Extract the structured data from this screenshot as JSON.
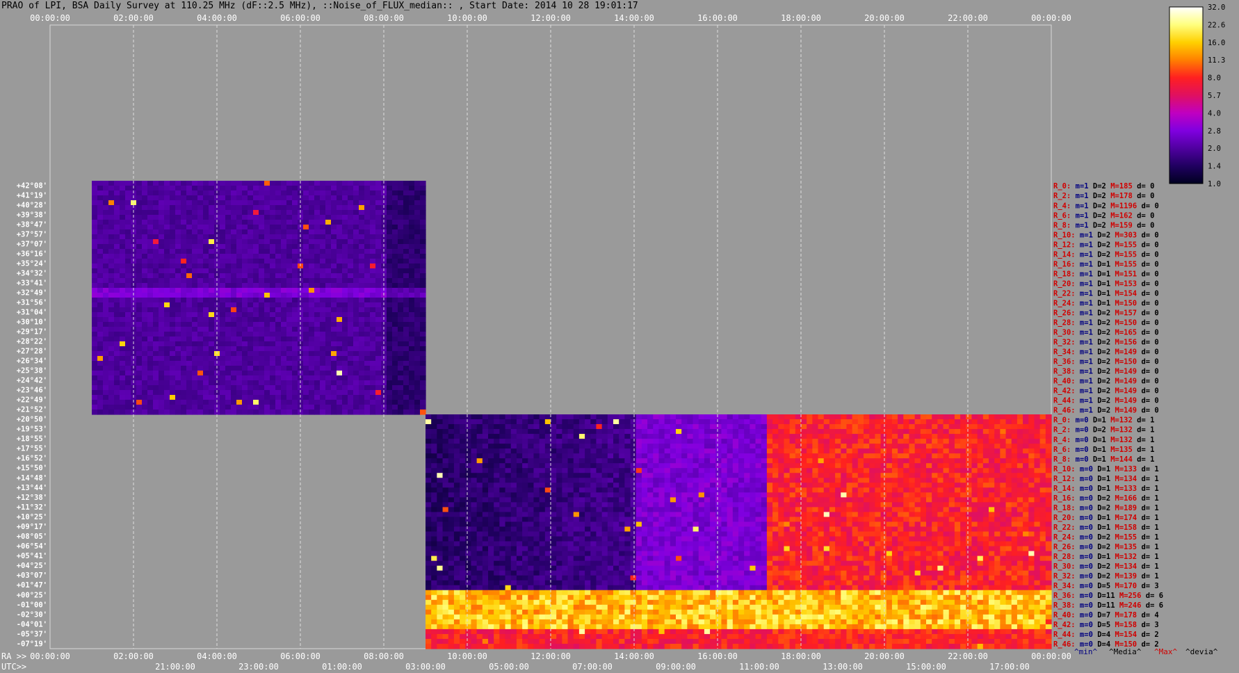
{
  "title": "PRAO of LPI, BSA Daily Survey at 110.25 MHz (dF::2.5 MHz), ::Noise_of_FLUX_median:: , Start Date: 2014 10 28 19:01:17",
  "colorbar": {
    "ticks": [
      "32.0",
      "22.6",
      "16.0",
      "11.3",
      "8.0",
      "5.7",
      "4.0",
      "2.8",
      "2.0",
      "1.4",
      "1.0"
    ],
    "colors": [
      "#ffffff",
      "#ffff80",
      "#ffd000",
      "#ff8000",
      "#ff2020",
      "#e01060",
      "#c000c0",
      "#8000e0",
      "#5000a0",
      "#200060",
      "#000020"
    ]
  },
  "axes": {
    "top_ticks": [
      "00:00:00",
      "02:00:00",
      "04:00:00",
      "06:00:00",
      "08:00:00",
      "10:00:00",
      "12:00:00",
      "14:00:00",
      "16:00:00",
      "18:00:00",
      "20:00:00",
      "22:00:00",
      "00:00:00"
    ],
    "ra_label": "RA >>",
    "bottom_ra_ticks": [
      "00:00:00",
      "02:00:00",
      "04:00:00",
      "06:00:00",
      "08:00:00",
      "10:00:00",
      "12:00:00",
      "14:00:00",
      "16:00:00",
      "18:00:00",
      "20:00:00",
      "22:00:00",
      "00:00:00"
    ],
    "utc_label": "UTC>>",
    "bottom_utc_ticks": [
      "21:00:00",
      "23:00:00",
      "01:00:00",
      "03:00:00",
      "05:00:00",
      "07:00:00",
      "09:00:00",
      "11:00:00",
      "13:00:00",
      "15:00:00",
      "17:00:00"
    ]
  },
  "chart_data": {
    "type": "heatmap",
    "title": "PRAO of LPI, BSA Daily Survey at 110.25 MHz (dF::2.5 MHz), ::Noise_of_FLUX_median:: , Start Date: 2014 10 28 19:01:17",
    "x_unit": "RA (h)",
    "xlim": [
      0,
      24
    ],
    "row_group_1": {
      "rows": 48,
      "ra_range": [
        1.0,
        9.0
      ],
      "declinations": [
        "+42°08'",
        "+41°19'",
        "+40°28'",
        "+39°38'",
        "+38°47'",
        "+37°57'",
        "+37°07'",
        "+36°16'",
        "+35°24'",
        "+34°32'",
        "+33°41'",
        "+32°49'",
        "+31°56'",
        "+31°04'",
        "+30°10'",
        "+29°17'",
        "+28°22'",
        "+27°28'",
        "+26°34'",
        "+25°38'",
        "+24°42'",
        "+23°46'",
        "+22°49'",
        "+21°52'"
      ]
    },
    "row_group_2": {
      "rows": 48,
      "ra_range": [
        9.0,
        24.0
      ],
      "declinations": [
        "+20°50'",
        "+19°53'",
        "+18°55'",
        "+17°55'",
        "+16°52'",
        "+15°50'",
        "+14°48'",
        "+13°44'",
        "+12°38'",
        "+11°32'",
        "+10°25'",
        "+09°17'",
        "+08°05'",
        "+06°54'",
        "+05°41'",
        "+04°25'",
        "+03°07'",
        "+01°47'",
        "+00°25'",
        "-01°00'",
        "-02°30'",
        "-04°01'",
        "-05°37'",
        "-07°19'"
      ]
    },
    "legend_header": [
      "^min^",
      "^Media^",
      "^Max^",
      "^devia^"
    ],
    "stats": [
      {
        "r": "R_0:",
        "m": "m=1",
        "D": "D=2",
        "M": "M=185",
        "d": "d= 0"
      },
      {
        "r": "R_2:",
        "m": "m=1",
        "D": "D=2",
        "M": "M=178",
        "d": "d= 0"
      },
      {
        "r": "R_4:",
        "m": "m=1",
        "D": "D=2",
        "M": "M=1196",
        "d": "d= 0"
      },
      {
        "r": "R_6:",
        "m": "m=1",
        "D": "D=2",
        "M": "M=162",
        "d": "d= 0"
      },
      {
        "r": "R_8:",
        "m": "m=1",
        "D": "D=2",
        "M": "M=159",
        "d": "d= 0"
      },
      {
        "r": "R_10:",
        "m": "m=1",
        "D": "D=2",
        "M": "M=303",
        "d": "d= 0"
      },
      {
        "r": "R_12:",
        "m": "m=1",
        "D": "D=2",
        "M": "M=155",
        "d": "d= 0"
      },
      {
        "r": "R_14:",
        "m": "m=1",
        "D": "D=2",
        "M": "M=155",
        "d": "d= 0"
      },
      {
        "r": "R_16:",
        "m": "m=1",
        "D": "D=1",
        "M": "M=155",
        "d": "d= 0"
      },
      {
        "r": "R_18:",
        "m": "m=1",
        "D": "D=1",
        "M": "M=151",
        "d": "d= 0"
      },
      {
        "r": "R_20:",
        "m": "m=1",
        "D": "D=1",
        "M": "M=153",
        "d": "d= 0"
      },
      {
        "r": "R_22:",
        "m": "m=1",
        "D": "D=1",
        "M": "M=154",
        "d": "d= 0"
      },
      {
        "r": "R_24:",
        "m": "m=1",
        "D": "D=1",
        "M": "M=150",
        "d": "d= 0"
      },
      {
        "r": "R_26:",
        "m": "m=1",
        "D": "D=2",
        "M": "M=157",
        "d": "d= 0"
      },
      {
        "r": "R_28:",
        "m": "m=1",
        "D": "D=2",
        "M": "M=150",
        "d": "d= 0"
      },
      {
        "r": "R_30:",
        "m": "m=1",
        "D": "D=2",
        "M": "M=165",
        "d": "d= 0"
      },
      {
        "r": "R_32:",
        "m": "m=1",
        "D": "D=2",
        "M": "M=156",
        "d": "d= 0"
      },
      {
        "r": "R_34:",
        "m": "m=1",
        "D": "D=2",
        "M": "M=149",
        "d": "d= 0"
      },
      {
        "r": "R_36:",
        "m": "m=1",
        "D": "D=2",
        "M": "M=150",
        "d": "d= 0"
      },
      {
        "r": "R_38:",
        "m": "m=1",
        "D": "D=2",
        "M": "M=149",
        "d": "d= 0"
      },
      {
        "r": "R_40:",
        "m": "m=1",
        "D": "D=2",
        "M": "M=149",
        "d": "d= 0"
      },
      {
        "r": "R_42:",
        "m": "m=1",
        "D": "D=2",
        "M": "M=149",
        "d": "d= 0"
      },
      {
        "r": "R_44:",
        "m": "m=1",
        "D": "D=2",
        "M": "M=149",
        "d": "d= 0"
      },
      {
        "r": "R_46:",
        "m": "m=1",
        "D": "D=2",
        "M": "M=149",
        "d": "d= 0"
      },
      {
        "r": "R_0:",
        "m": "m=0",
        "D": "D=1",
        "M": "M=132",
        "d": "d= 1"
      },
      {
        "r": "R_2:",
        "m": "m=0",
        "D": "D=2",
        "M": "M=132",
        "d": "d= 1"
      },
      {
        "r": "R_4:",
        "m": "m=0",
        "D": "D=1",
        "M": "M=132",
        "d": "d= 1"
      },
      {
        "r": "R_6:",
        "m": "m=0",
        "D": "D=1",
        "M": "M=135",
        "d": "d= 1"
      },
      {
        "r": "R_8:",
        "m": "m=0",
        "D": "D=1",
        "M": "M=144",
        "d": "d= 1"
      },
      {
        "r": "R_10:",
        "m": "m=0",
        "D": "D=1",
        "M": "M=133",
        "d": "d= 1"
      },
      {
        "r": "R_12:",
        "m": "m=0",
        "D": "D=1",
        "M": "M=134",
        "d": "d= 1"
      },
      {
        "r": "R_14:",
        "m": "m=0",
        "D": "D=1",
        "M": "M=133",
        "d": "d= 1"
      },
      {
        "r": "R_16:",
        "m": "m=0",
        "D": "D=2",
        "M": "M=166",
        "d": "d= 1"
      },
      {
        "r": "R_18:",
        "m": "m=0",
        "D": "D=2",
        "M": "M=189",
        "d": "d= 1"
      },
      {
        "r": "R_20:",
        "m": "m=0",
        "D": "D=1",
        "M": "M=174",
        "d": "d= 1"
      },
      {
        "r": "R_22:",
        "m": "m=0",
        "D": "D=1",
        "M": "M=158",
        "d": "d= 1"
      },
      {
        "r": "R_24:",
        "m": "m=0",
        "D": "D=2",
        "M": "M=155",
        "d": "d= 1"
      },
      {
        "r": "R_26:",
        "m": "m=0",
        "D": "D=2",
        "M": "M=135",
        "d": "d= 1"
      },
      {
        "r": "R_28:",
        "m": "m=0",
        "D": "D=1",
        "M": "M=132",
        "d": "d= 1"
      },
      {
        "r": "R_30:",
        "m": "m=0",
        "D": "D=2",
        "M": "M=134",
        "d": "d= 1"
      },
      {
        "r": "R_32:",
        "m": "m=0",
        "D": "D=2",
        "M": "M=139",
        "d": "d= 1"
      },
      {
        "r": "R_34:",
        "m": "m=0",
        "D": "D=5",
        "M": "M=170",
        "d": "d= 3"
      },
      {
        "r": "R_36:",
        "m": "m=0",
        "D": "D=11",
        "M": "M=256",
        "d": "d= 6"
      },
      {
        "r": "R_38:",
        "m": "m=0",
        "D": "D=11",
        "M": "M=246",
        "d": "d= 6"
      },
      {
        "r": "R_40:",
        "m": "m=0",
        "D": "D=7",
        "M": "M=178",
        "d": "d= 4"
      },
      {
        "r": "R_42:",
        "m": "m=0",
        "D": "D=5",
        "M": "M=158",
        "d": "d= 3"
      },
      {
        "r": "R_44:",
        "m": "m=0",
        "D": "D=4",
        "M": "M=154",
        "d": "d= 2"
      },
      {
        "r": "R_46:",
        "m": "m=0",
        "D": "D=4",
        "M": "M=150",
        "d": "d= 2"
      }
    ]
  }
}
